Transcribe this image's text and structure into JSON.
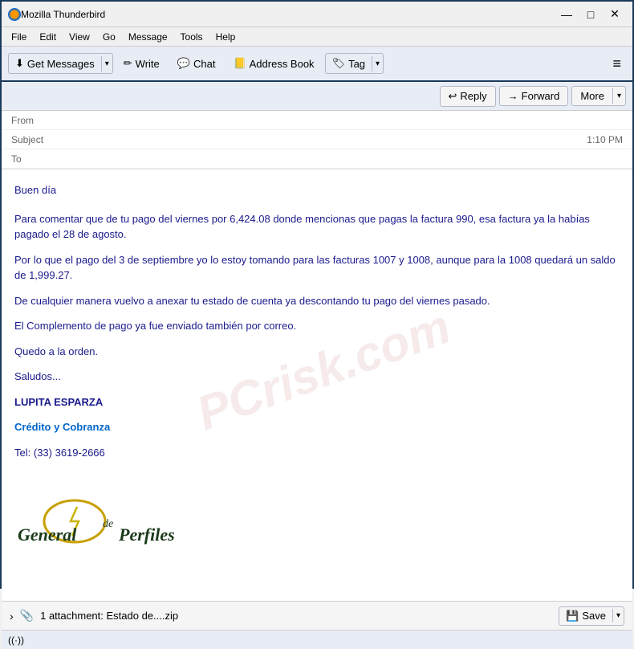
{
  "window": {
    "title": "Mozilla Thunderbird",
    "controls": {
      "minimize": "—",
      "maximize": "□",
      "close": "✕"
    }
  },
  "menubar": {
    "items": [
      "File",
      "Edit",
      "View",
      "Go",
      "Message",
      "Tools",
      "Help"
    ]
  },
  "toolbar": {
    "get_messages_label": "Get Messages",
    "write_label": "Write",
    "chat_label": "Chat",
    "address_book_label": "Address Book",
    "tag_label": "Tag",
    "hamburger": "≡"
  },
  "action_toolbar": {
    "reply_label": "Reply",
    "forward_label": "Forward",
    "more_label": "More"
  },
  "email_header": {
    "from_label": "From",
    "from_value": "",
    "subject_label": "Subject",
    "subject_value": "",
    "time": "1:10 PM",
    "to_label": "To",
    "to_value": ""
  },
  "email_body": {
    "greeting": "Buen día",
    "paragraph1": "Para comentar que de tu pago del viernes por  6,424.08 donde mencionas que pagas la factura 990, esa factura ya la habías pagado el 28 de agosto.",
    "paragraph2": "Por lo que el pago del 3 de septiembre yo lo estoy tomando para las facturas 1007 y 1008, aunque para la 1008 quedará un saldo de 1,999.27.",
    "paragraph3": "De cualquier manera vuelvo a anexar tu estado de cuenta ya descontando tu pago del viernes pasado.",
    "paragraph4": "El Complemento de pago ya fue enviado también por correo.",
    "paragraph5": "Quedo a la orden.",
    "paragraph6": "Saludos...",
    "signature_name": "LUPITA ESPARZA",
    "signature_dept": "Crédito y Cobranza",
    "signature_tel_label": "Tel:",
    "signature_tel": "(33) 3619-2666",
    "company_name": "General de Perfiles"
  },
  "attachment": {
    "count_label": "1 attachment: Estado de....zip",
    "save_label": "Save"
  },
  "statusbar": {
    "signal_icon": "((·))"
  }
}
